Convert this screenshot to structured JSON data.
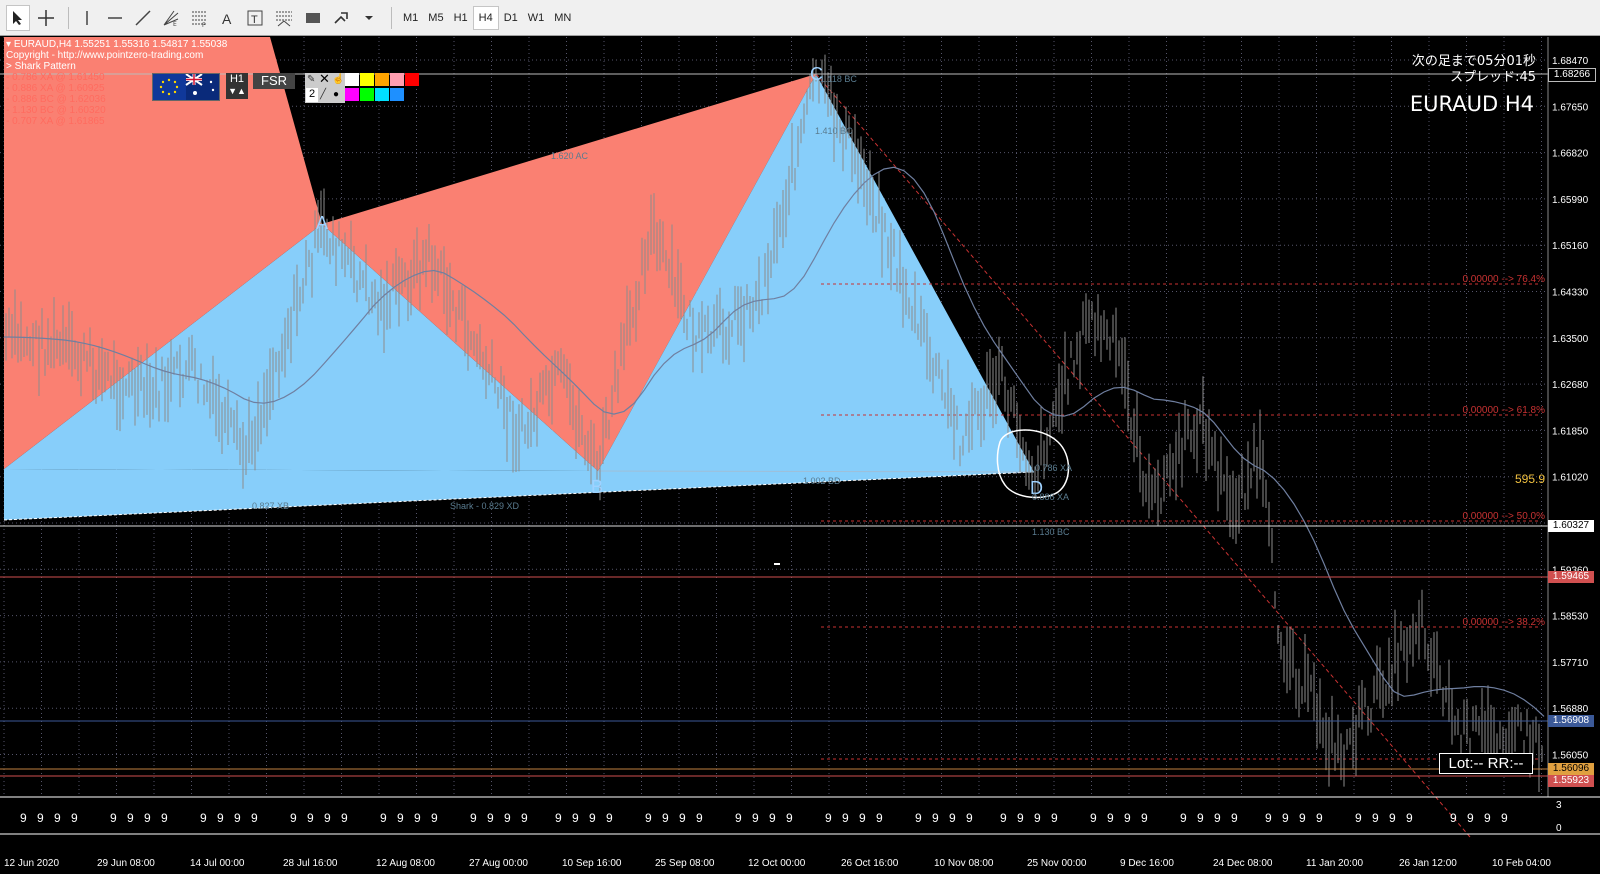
{
  "toolbar": {
    "timeframes": [
      "M1",
      "M5",
      "H1",
      "H4",
      "D1",
      "W1",
      "MN"
    ],
    "active_timeframe": "H4",
    "tools": [
      "cursor-icon",
      "crosshair-icon",
      "vertical-line-icon",
      "horizontal-line-icon",
      "trendline-icon",
      "gann-icon",
      "fibo-icon",
      "text-icon",
      "text-label-icon",
      "fibo-fan-icon",
      "rectangle-icon",
      "arrows-icon",
      "dropdown-arrow-icon"
    ]
  },
  "chart_info": {
    "header_line": "EURAUD,H4  1.55251 1.55316 1.54817 1.55038",
    "copyright": "Copyright - http://www.pointzero-trading.com",
    "pattern_name": "> Shark Pattern",
    "levels": [
      "- 0.786 XA @ 1.61450",
      "- 0.886 XA @ 1.60925",
      "- 0.886 BC @ 1.62036",
      "- 1.130 BC @ 1.60320",
      "- 0.707 XA @ 1.61865"
    ]
  },
  "panel": {
    "pair_flags": "EUR/AUD",
    "timeframe_label": "H1",
    "fsr_label": "FSR",
    "number_label": "2",
    "palette": [
      "#ffffff",
      "#ffff00",
      "#ffa500",
      "#ff9eb0",
      "#ff0000",
      "#ff00ff",
      "#00ff00",
      "#00e0ff",
      "#1e90ff"
    ]
  },
  "countdown": "次の足まで05分01秒",
  "spread": "スプレッド:45",
  "symbol_title": "EURAUD H4",
  "pattern_points": {
    "X": "X",
    "A": "A",
    "B": "B",
    "C": "C",
    "D": "D"
  },
  "pattern_labels": [
    "1.620 AC",
    "1.118 BC",
    "1.410 BC",
    "0.827 XB",
    "Shark - 0.829 XD",
    "1.002 BD",
    "0.786 XA",
    "0.886 XA",
    "1.130 BC"
  ],
  "fib_labels": [
    "0.00000 --> 76.4%",
    "0.00000 --> 61.8%",
    "0.00000 --> 50.0%",
    "0.00000 --> 38.2%"
  ],
  "distance_value": "595.9",
  "lot_box": "Lot:--  RR:--",
  "price_axis": [
    "1.68470",
    "1.67650",
    "1.66820",
    "1.65990",
    "1.65160",
    "1.64330",
    "1.63500",
    "1.62680",
    "1.61850",
    "1.61020",
    "1.60190",
    "1.59360",
    "1.58530",
    "1.57710",
    "1.56880",
    "1.56050"
  ],
  "price_tags": {
    "top": "1.68266",
    "mid": "1.60327",
    "red1": "1.59465",
    "current": "1.56908",
    "orange": "1.56096",
    "red2": "1.55923"
  },
  "time_axis": [
    "12 Jun 2020",
    "29 Jun 08:00",
    "14 Jul 00:00",
    "28 Jul 16:00",
    "12 Aug 08:00",
    "27 Aug 00:00",
    "10 Sep 16:00",
    "25 Sep 08:00",
    "12 Oct 00:00",
    "26 Oct 16:00",
    "10 Nov 08:00",
    "25 Nov 00:00",
    "9 Dec 16:00",
    "24 Dec 08:00",
    "11 Jan 20:00",
    "26 Jan 12:00",
    "10 Feb 04:00"
  ],
  "indicator": {
    "digit": "9",
    "scale_top": "3",
    "scale_bottom": "0"
  },
  "colors": {
    "background": "#000000",
    "grid": "#55556a",
    "pattern_red": "#fa8072",
    "pattern_blue": "#87cefa",
    "candle_gray": "#8c8c8c",
    "fib_red": "#c83232",
    "ma_line": "#6f7fa0",
    "current_price": "#3b5998"
  }
}
